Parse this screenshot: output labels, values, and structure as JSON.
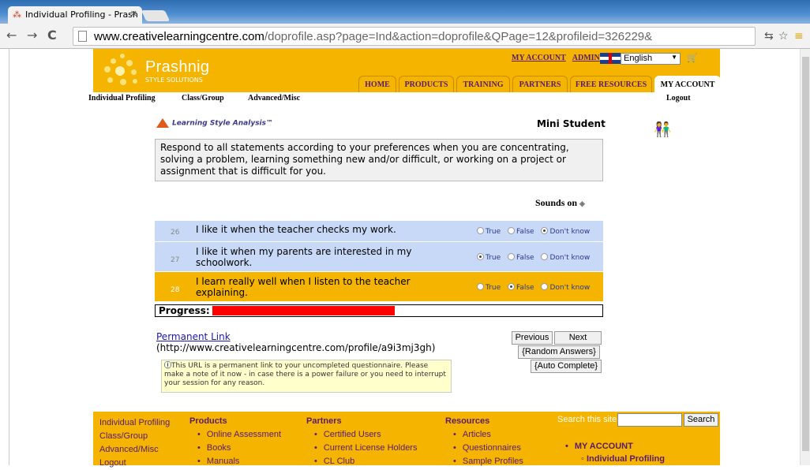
{
  "browser": {
    "tab_title": "Individual Profiling - Prash",
    "tab_close": "✕",
    "url_host": "www.creativelearningcentre.com",
    "url_path": "/doprofile.asp?page=Ind&action=doprofile&QPage=12&profileid=326229&"
  },
  "header": {
    "logo_text": "Prashnig",
    "logo_sub": "STYLE SOLUTIONS",
    "my_account_link": "MY ACCOUNT",
    "admin_link": "ADMIN",
    "language": "English",
    "nav": [
      "HOME",
      "PRODUCTS",
      "TRAINING",
      "PARTNERS",
      "FREE RESOURCES",
      "MY ACCOUNT"
    ],
    "active_nav": "MY ACCOUNT"
  },
  "subnav": {
    "individual": "Individual Profiling",
    "class_group": "Class/Group",
    "advanced": "Advanced/Misc",
    "logout": "Logout"
  },
  "content": {
    "lsa_logo": "Learning Style Analysis™",
    "product_title": "Mini Student",
    "intro": "Respond to all statements according to your preferences when you are concentrating, solving a problem, learning something new and/or difficult, or working on a project or assignment that is difficult for you.",
    "sounds": "Sounds on",
    "option_labels": [
      "True",
      "False",
      "Don't know"
    ],
    "questions": [
      {
        "num": "26",
        "text": "I like it when the teacher checks my work.",
        "selected": 2
      },
      {
        "num": "27",
        "text": "I like it when my parents are interested in my schoolwork.",
        "selected": 0
      },
      {
        "num": "28",
        "text": "I learn really well when I listen to the teacher explaining.",
        "selected": 1
      }
    ],
    "progress_label": "Progress:",
    "progress_fraction": 0.47,
    "permanent_link": "Permanent Link",
    "permanent_url": "(http://www.creativelearningcentre.com/profile/a9i3mj3gh)",
    "note": "This URL is a permanent link to your uncompleted questionnaire. Please make a note of it now - in case there is a power failure or you need to interrupt your session for any reason.",
    "btn_previous": "Previous",
    "btn_next": "Next",
    "btn_random": "{Random Answers}",
    "btn_auto": "{Auto Complete}"
  },
  "footer": {
    "col1": [
      "Individual Profiling",
      "Class/Group",
      "Advanced/Misc",
      "Logout"
    ],
    "products_head": "Products",
    "products": [
      "Online Assessment",
      "Books",
      "Manuals"
    ],
    "partners_head": "Partners",
    "partners": [
      "Certified Users",
      "Current License Holders",
      "CL Club"
    ],
    "resources_head": "Resources",
    "resources": [
      "Articles",
      "Questionnaires",
      "Sample Profiles"
    ],
    "search_label": "Search this site:",
    "search_button": "Search",
    "my_account": "MY ACCOUNT",
    "my_account_sub": "Individual Profiling"
  }
}
